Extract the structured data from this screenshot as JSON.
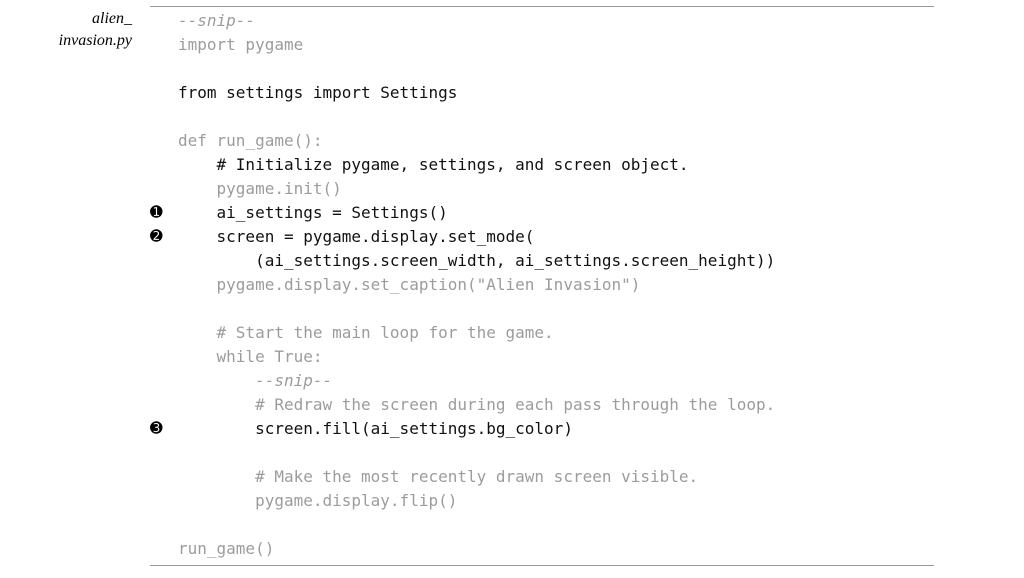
{
  "filename_line1": "alien_",
  "filename_line2": "invasion.py",
  "lines": [
    {
      "callout": "",
      "segments": [
        {
          "text": "--snip--",
          "cls": "dim-italic"
        }
      ]
    },
    {
      "callout": "",
      "segments": [
        {
          "text": "import pygame",
          "cls": "dim"
        }
      ]
    },
    {
      "callout": "",
      "segments": [
        {
          "text": " ",
          "cls": "dim"
        }
      ]
    },
    {
      "callout": "",
      "segments": [
        {
          "text": "from settings import Settings",
          "cls": "strong"
        }
      ]
    },
    {
      "callout": "",
      "segments": [
        {
          "text": " ",
          "cls": "dim"
        }
      ]
    },
    {
      "callout": "",
      "segments": [
        {
          "text": "def run_game():",
          "cls": "dim"
        }
      ]
    },
    {
      "callout": "",
      "segments": [
        {
          "text": "    # Initialize pygame, settings, and screen object.",
          "cls": "strong"
        }
      ]
    },
    {
      "callout": "",
      "segments": [
        {
          "text": "    pygame.init()",
          "cls": "dim"
        }
      ]
    },
    {
      "callout": "➊",
      "segments": [
        {
          "text": "    ai_settings = Settings()",
          "cls": "strong"
        }
      ]
    },
    {
      "callout": "➋",
      "segments": [
        {
          "text": "    screen = pygame.display.set_mode(",
          "cls": "strong"
        }
      ]
    },
    {
      "callout": "",
      "segments": [
        {
          "text": "        (ai_settings.screen_width, ai_settings.screen_height))",
          "cls": "strong"
        }
      ]
    },
    {
      "callout": "",
      "segments": [
        {
          "text": "    pygame.display.set_caption(\"Alien Invasion\")",
          "cls": "dim"
        }
      ]
    },
    {
      "callout": "",
      "segments": [
        {
          "text": " ",
          "cls": "dim"
        }
      ]
    },
    {
      "callout": "",
      "segments": [
        {
          "text": "    # Start the main loop for the game.",
          "cls": "dim"
        }
      ]
    },
    {
      "callout": "",
      "segments": [
        {
          "text": "    while True:",
          "cls": "dim"
        }
      ]
    },
    {
      "callout": "",
      "segments": [
        {
          "text": "        ",
          "cls": "dim"
        },
        {
          "text": "--snip--",
          "cls": "dim-italic"
        }
      ]
    },
    {
      "callout": "",
      "segments": [
        {
          "text": "        # Redraw the screen during each pass through the loop.",
          "cls": "dim"
        }
      ]
    },
    {
      "callout": "➌",
      "segments": [
        {
          "text": "        screen.fill(ai_settings.bg_color)",
          "cls": "strong"
        }
      ]
    },
    {
      "callout": "",
      "segments": [
        {
          "text": " ",
          "cls": "dim"
        }
      ]
    },
    {
      "callout": "",
      "segments": [
        {
          "text": "        # Make the most recently drawn screen visible.",
          "cls": "dim"
        }
      ]
    },
    {
      "callout": "",
      "segments": [
        {
          "text": "        pygame.display.flip()",
          "cls": "dim"
        }
      ]
    },
    {
      "callout": "",
      "segments": [
        {
          "text": " ",
          "cls": "dim"
        }
      ]
    },
    {
      "callout": "",
      "segments": [
        {
          "text": "run_game()",
          "cls": "dim"
        }
      ]
    }
  ]
}
